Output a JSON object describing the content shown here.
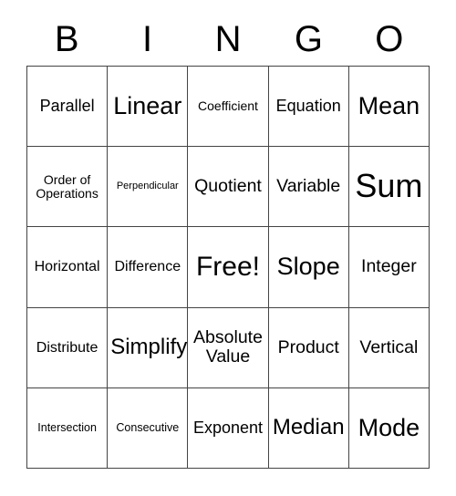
{
  "card": {
    "header": {
      "letters": [
        "B",
        "I",
        "N",
        "G",
        "O"
      ]
    },
    "free_space_label": "Free!",
    "rows": [
      [
        {
          "label": "Parallel",
          "size": "fs-l"
        },
        {
          "label": "Linear",
          "size": "fs-3xl"
        },
        {
          "label": "Coefficient",
          "size": "fs-s"
        },
        {
          "label": "Equation",
          "size": "fs-l"
        },
        {
          "label": "Mean",
          "size": "fs-3xl"
        }
      ],
      [
        {
          "label": "Order of\nOperations",
          "size": "fs-s"
        },
        {
          "label": "Perpendicular",
          "size": "fs-xxs"
        },
        {
          "label": "Quotient",
          "size": "fs-xl"
        },
        {
          "label": "Variable",
          "size": "fs-xl"
        },
        {
          "label": "Sum",
          "size": "fs-5xl"
        }
      ],
      [
        {
          "label": "Horizontal",
          "size": "fs-m"
        },
        {
          "label": "Difference",
          "size": "fs-m"
        },
        {
          "label": "Free!",
          "size": "fs-4xl"
        },
        {
          "label": "Slope",
          "size": "fs-3xl"
        },
        {
          "label": "Integer",
          "size": "fs-xl"
        }
      ],
      [
        {
          "label": "Distribute",
          "size": "fs-m"
        },
        {
          "label": "Simplify",
          "size": "fs-2xl"
        },
        {
          "label": "Absolute\nValue",
          "size": "fs-xl"
        },
        {
          "label": "Product",
          "size": "fs-xl"
        },
        {
          "label": "Vertical",
          "size": "fs-xl"
        }
      ],
      [
        {
          "label": "Intersection",
          "size": "fs-xs"
        },
        {
          "label": "Consecutive",
          "size": "fs-xs"
        },
        {
          "label": "Exponent",
          "size": "fs-l"
        },
        {
          "label": "Median",
          "size": "fs-2xl"
        },
        {
          "label": "Mode",
          "size": "fs-3xl"
        }
      ]
    ]
  },
  "colors": {
    "background": "#ffffff",
    "text": "#000000",
    "border": "#444444"
  }
}
